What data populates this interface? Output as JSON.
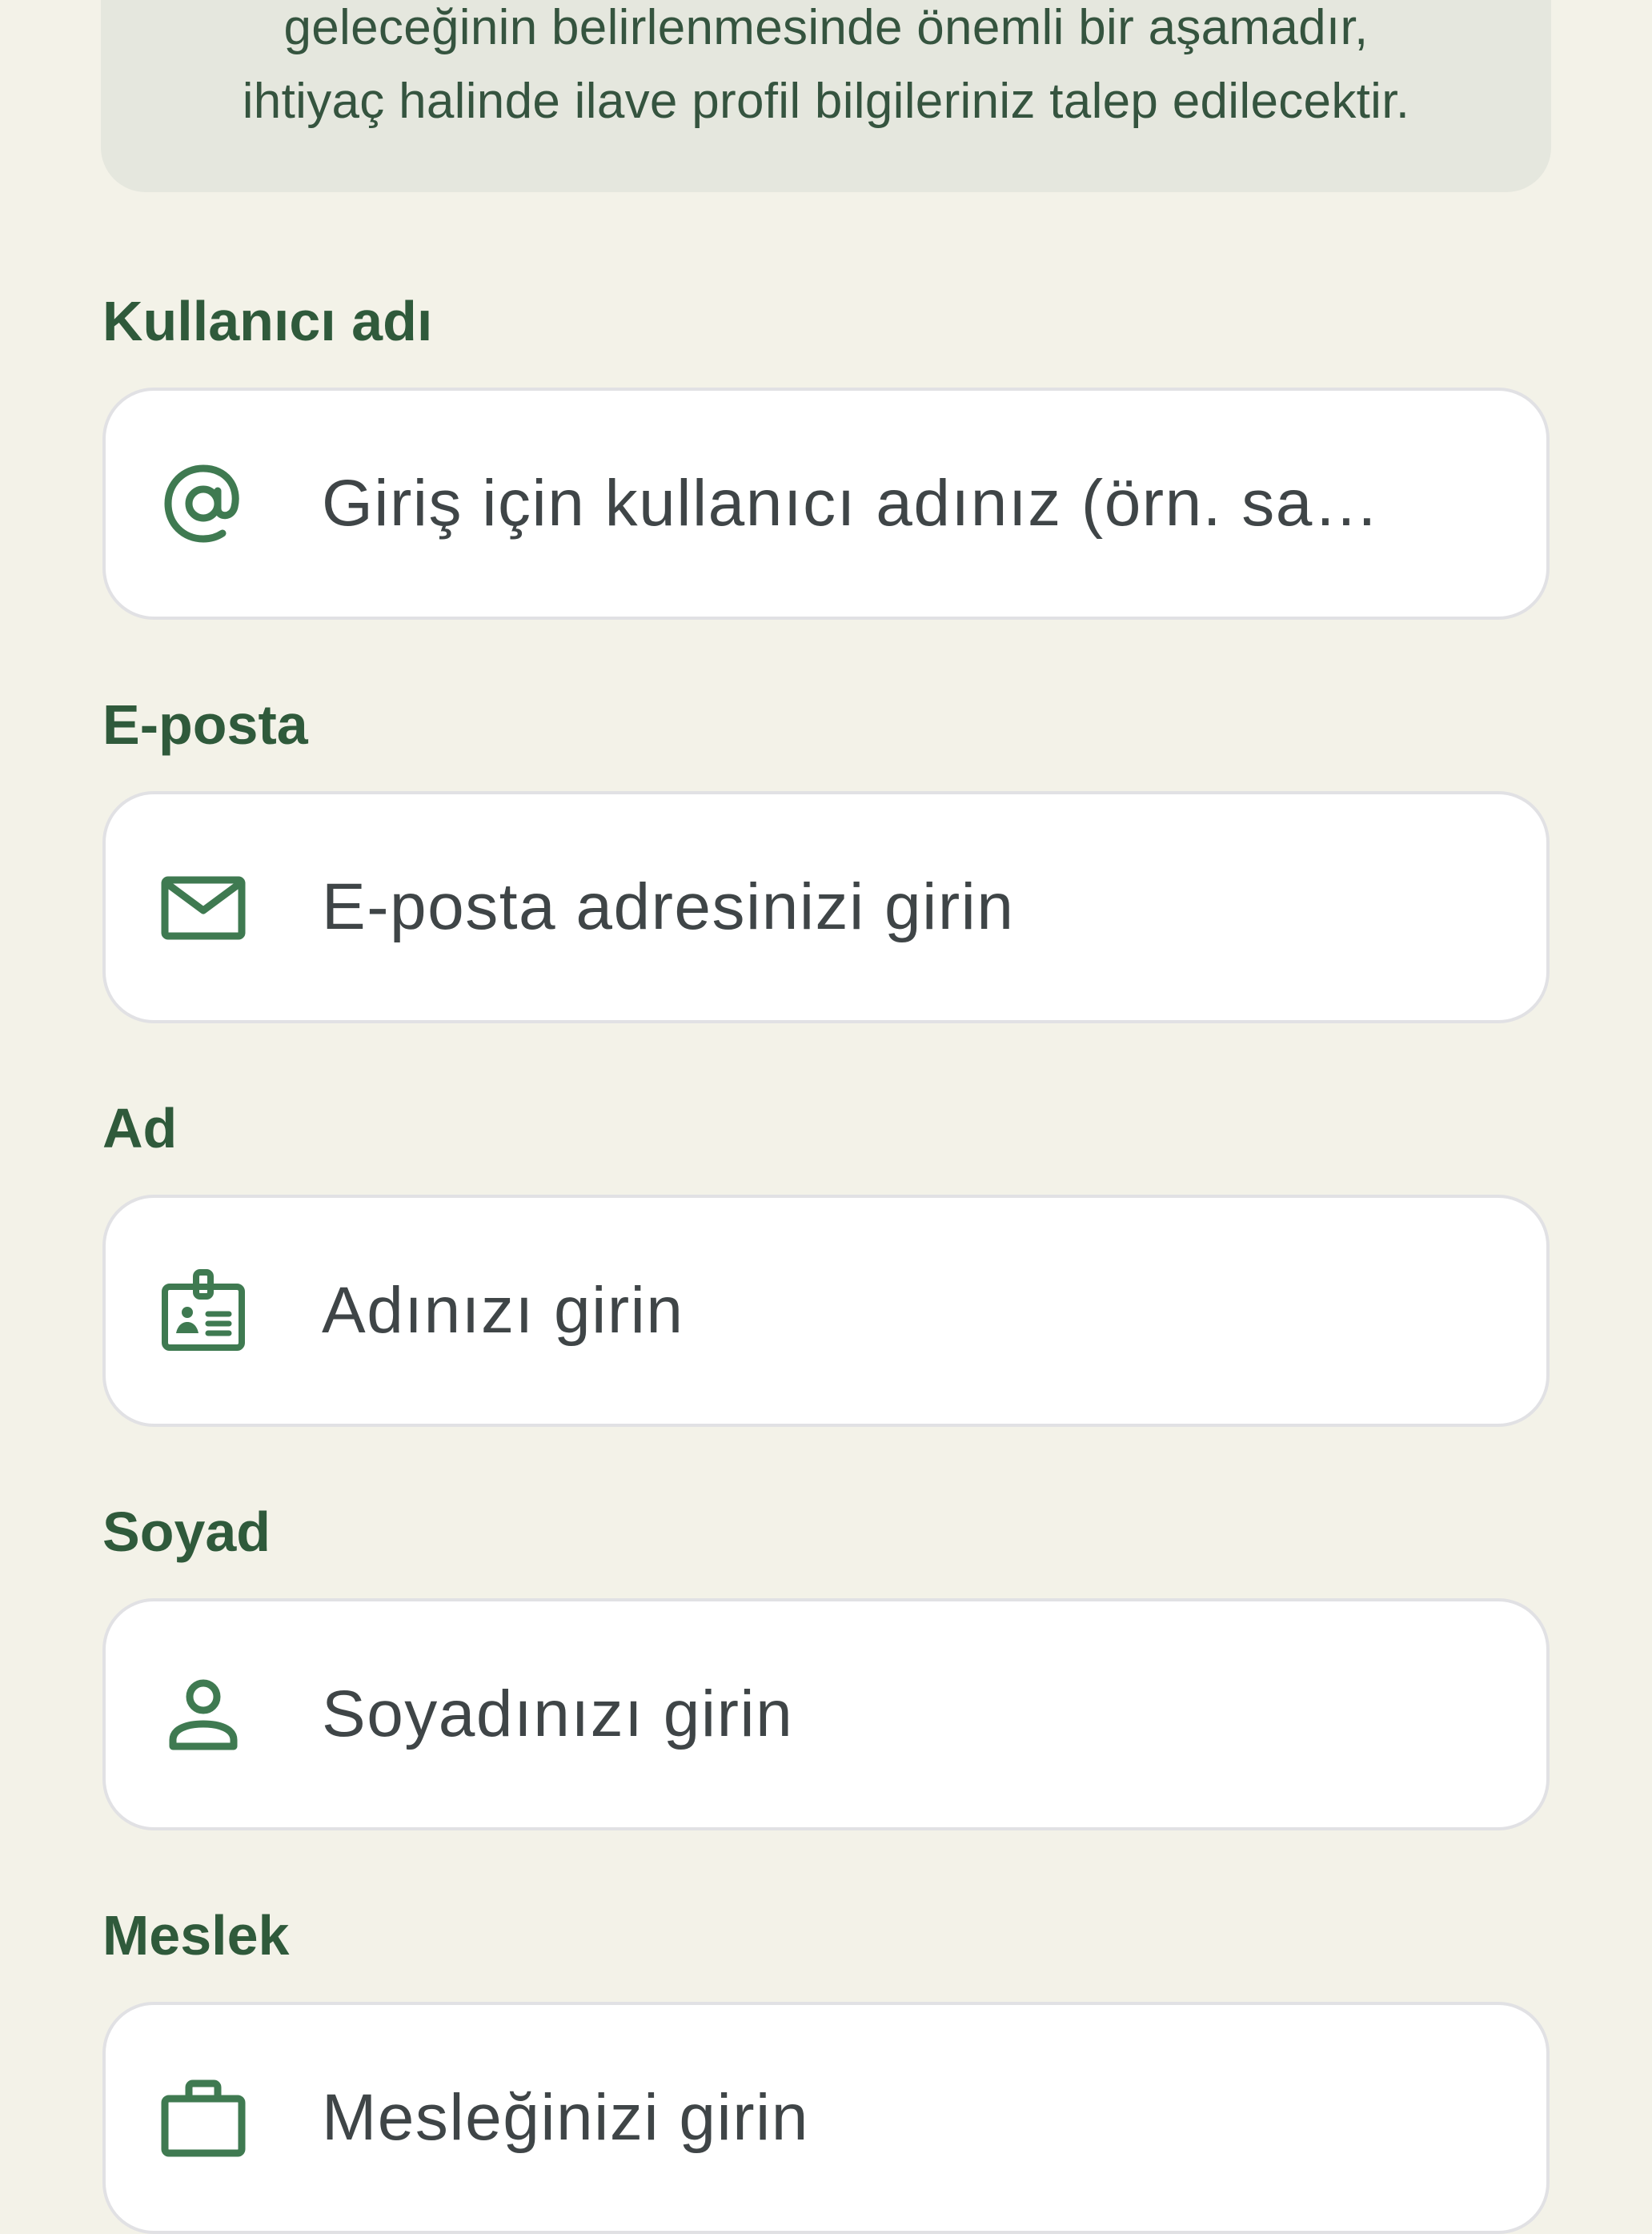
{
  "info_card": {
    "line1": "geleceğinin belirlenmesinde önemli bir aşamadır,",
    "line2": "ihtiyaç halinde ilave profil bilgileriniz talep edilecektir."
  },
  "fields": {
    "username": {
      "label": "Kullanıcı adı",
      "placeholder": "Giriş için kullanıcı adınız (örn. sa…",
      "icon": "at-icon"
    },
    "email": {
      "label": "E-posta",
      "placeholder": "E-posta adresinizi girin",
      "icon": "mail-icon"
    },
    "first_name": {
      "label": "Ad",
      "placeholder": "Adınızı girin",
      "icon": "id-badge-icon"
    },
    "last_name": {
      "label": "Soyad",
      "placeholder": "Soyadınızı girin",
      "icon": "person-icon"
    },
    "profession": {
      "label": "Meslek",
      "placeholder": "Mesleğinizi girin",
      "icon": "briefcase-icon"
    }
  },
  "colors": {
    "background": "#f3f2e8",
    "info_card": "#e5e7de",
    "accent_green": "#3f7a51",
    "label_text": "#2f5a3b",
    "field_border": "#e1e1e4"
  }
}
